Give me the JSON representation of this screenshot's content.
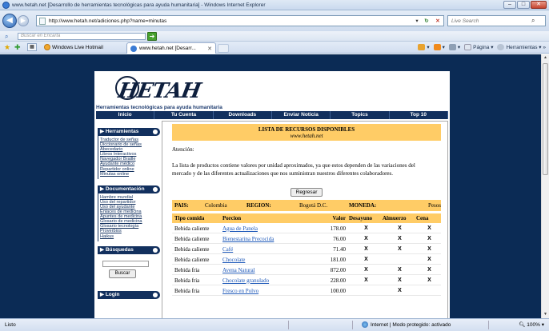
{
  "window": {
    "title": "www.hetah.net [Desarrollo de herramientas tecnológicas para ayuda humanitaria] - Windows Internet Explorer",
    "minimize": "–",
    "maximize": "□",
    "close": "✕"
  },
  "address": {
    "url": "http://www.hetah.net/adiciones.php?name=minutas",
    "search_placeholder": "Live Search"
  },
  "toolbar": {
    "search_placeholder": "Buscar en Encarta",
    "go": "➔"
  },
  "tabs": {
    "favorite": "Windows Live Hotmail",
    "active_tab": "www.hetah.net [Desarr...",
    "page_menu": "Página",
    "tools_menu": "Herramientas"
  },
  "site": {
    "brand": "HETAH",
    "tagline": "Herramientas tecnológicas para ayuda humanitaria",
    "menu": [
      "Inicio",
      "Tu Cuenta",
      "Downloads",
      "Enviar Noticia",
      "Topics",
      "Top 10"
    ],
    "sidebar": {
      "herramientas_title": "Herramientas",
      "herramientas": [
        "Traductor de señas",
        "Diccionario de señas",
        "Abecedario",
        "Libros Interactivos",
        "Navegador Braille",
        "Ayudante médico",
        "Repartidor online",
        "Minutas online"
      ],
      "documentacion_title": "Documentación",
      "documentacion": [
        "Hambre mundial",
        "Uso del repartidor",
        "Uso del ayudante",
        "Enlaces de medicina",
        "Apuntes de medicina",
        "Glosario de medicina",
        "Glosario tecnología",
        "Proverbios",
        "Haikus"
      ],
      "busquedas_title": "Búsquedas",
      "buscar_button": "Buscar",
      "login_title": "Login"
    },
    "content": {
      "heading": "LISTA DE RECURSOS DISPONIBLES",
      "subheading": "www.hetah.net",
      "atencion": "Atención:",
      "paragraph": "La lista de productos contiene valores por unidad aproximados, ya que estos dependen de las variaciones del mercado y de las diferentes actualizaciones que nos suministran nuestros diferentes colaboradores.",
      "regresar": "Regresar",
      "info": {
        "pais_label": "PAIS:",
        "pais": "Colombia",
        "region_label": "REGION:",
        "region": "Bogotá D.C.",
        "moneda_label": "MONEDA:",
        "moneda": "Pesos"
      },
      "columns": [
        "Tipo comida",
        "Porcion",
        "Valor",
        "Desayuno",
        "Almuerzo",
        "Cena"
      ],
      "rows": [
        {
          "tipo": "Bebida caliente",
          "porcion": "Agua de Panela",
          "valor": "178.00",
          "desayuno": "X",
          "almuerzo": "X",
          "cena": "X"
        },
        {
          "tipo": "Bebida caliente",
          "porcion": "Bienestarina Precocida",
          "valor": "76.00",
          "desayuno": "X",
          "almuerzo": "X",
          "cena": "X"
        },
        {
          "tipo": "Bebida caliente",
          "porcion": "Café",
          "valor": "71.40",
          "desayuno": "X",
          "almuerzo": "X",
          "cena": "X"
        },
        {
          "tipo": "Bebida caliente",
          "porcion": "Chocolate",
          "valor": "181.00",
          "desayuno": "X",
          "almuerzo": "",
          "cena": "X"
        },
        {
          "tipo": "Bebida fria",
          "porcion": "Avena Natural",
          "valor": "872.00",
          "desayuno": "X",
          "almuerzo": "X",
          "cena": "X"
        },
        {
          "tipo": "Bebida fria",
          "porcion": "Chocolate granulado",
          "valor": "228.00",
          "desayuno": "X",
          "almuerzo": "X",
          "cena": "X"
        },
        {
          "tipo": "Bebida fria",
          "porcion": "Fresco en Polvo",
          "valor": "100.00",
          "desayuno": "",
          "almuerzo": "X",
          "cena": ""
        }
      ]
    }
  },
  "status": {
    "left": "Listo",
    "zone": "Internet | Modo protegido: activado",
    "zoom": "100%"
  }
}
